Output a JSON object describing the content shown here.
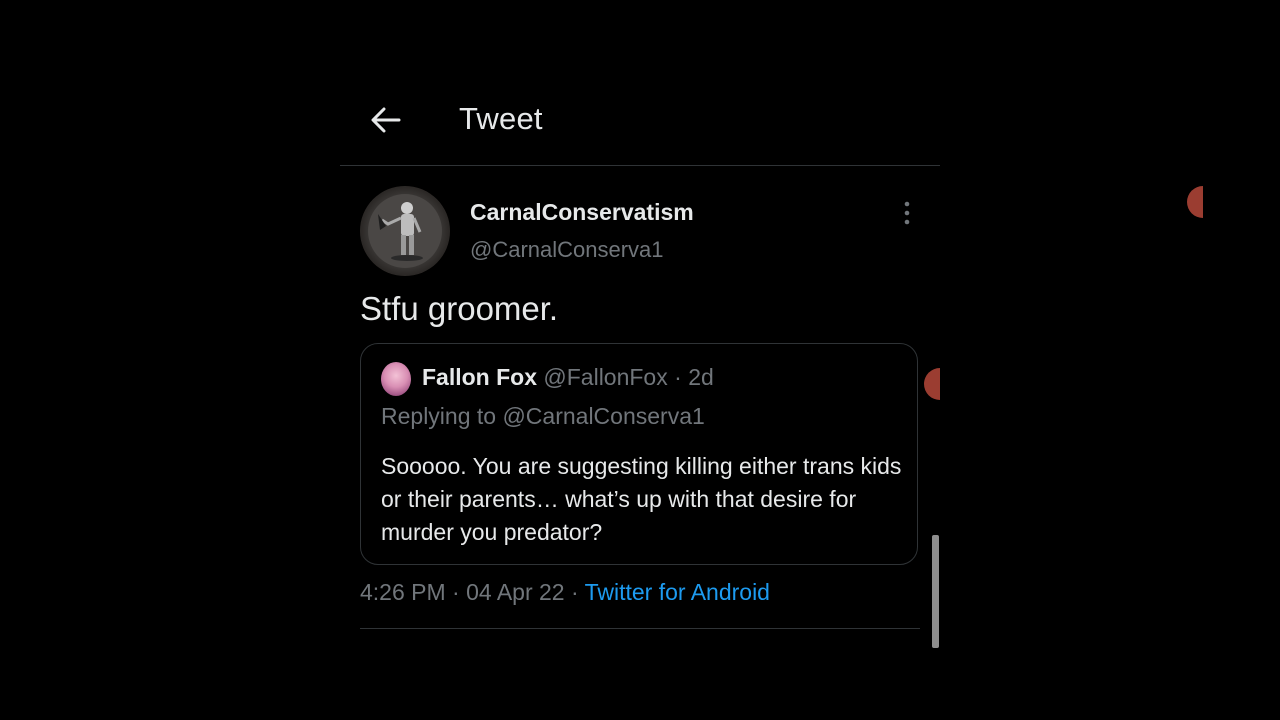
{
  "header": {
    "title": "Tweet",
    "back_icon": "arrow-left-icon"
  },
  "tweet": {
    "author_name": "CarnalConservatism",
    "author_handle": "@CarnalConserva1",
    "text": "Stfu groomer.",
    "more_icon": "more-vertical-icon",
    "time": "4:26 PM",
    "sep1": " · ",
    "date": "04 Apr 22",
    "sep2": " · ",
    "source": "Twitter for Android"
  },
  "quoted_tweet": {
    "name": "Fallon Fox",
    "handle": "@FallonFox",
    "age": "2d",
    "age_sep": " · ",
    "replying_to": "Replying to @CarnalConserva1",
    "text": "Sooooo. You are suggesting killing either trans kids or their parents… what’s up with that desire for murder you predator?"
  },
  "colors": {
    "background": "#000000",
    "text_primary": "#e7e9ea",
    "text_secondary": "#71767b",
    "link": "#1d9bf0",
    "border": "#2f3336"
  }
}
